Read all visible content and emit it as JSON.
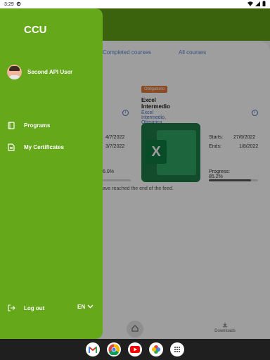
{
  "status_bar": {
    "time": "3:29"
  },
  "app": {
    "tabs": {
      "completed": "Completed courses",
      "all": "All courses"
    },
    "left_card": {
      "date1": "4/7/2022",
      "date2": "3/7/2022",
      "progress_text": "6.0%"
    },
    "course": {
      "badge": "Obligatorio",
      "title": "Excel Intermedio",
      "subtitle": "Excel Intermedio, Ofimática",
      "starts_label": "Starts:",
      "starts_value": "27/6/2022",
      "ends_label": "Ends:",
      "ends_value": "1/8/2022",
      "progress_label": "Progress: 85.2%",
      "progress_fraction": 0.852
    },
    "end_of_feed": "ave reached the end of the feed.",
    "bottom_nav": {
      "downloads_label": "Downloads"
    }
  },
  "drawer": {
    "logo_text": "CCU",
    "user_name": "Second API User",
    "menu": [
      {
        "label": "Programs",
        "icon": "book-icon"
      },
      {
        "label": "My Certificates",
        "icon": "certificate-icon"
      }
    ],
    "logout_label": "Log out",
    "language": "EN"
  },
  "dock": [
    "gmail-icon",
    "chrome-icon",
    "youtube-icon",
    "photos-icon",
    "app-drawer-icon"
  ],
  "colors": {
    "drawer_green": "#65a81a",
    "header_green": "#5fa017",
    "link_blue": "#4a73c4",
    "badge_orange": "#e07a3a"
  }
}
